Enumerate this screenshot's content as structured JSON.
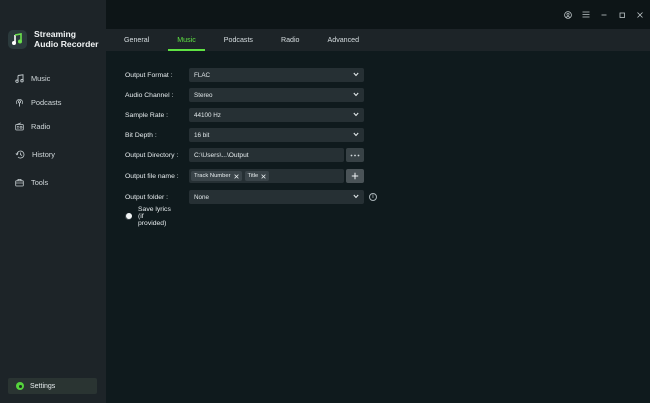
{
  "app": {
    "name_line1": "Streaming",
    "name_line2": "Audio Recorder"
  },
  "sidebar": {
    "items": [
      {
        "label": "Music",
        "icon": "music-icon"
      },
      {
        "label": "Podcasts",
        "icon": "podcast-icon"
      },
      {
        "label": "Radio",
        "icon": "radio-icon"
      },
      {
        "label": "History",
        "icon": "history-icon"
      },
      {
        "label": "Tools",
        "icon": "toolbox-icon"
      }
    ],
    "settings_label": "Settings"
  },
  "tabs": [
    {
      "label": "General",
      "active": false
    },
    {
      "label": "Music",
      "active": true
    },
    {
      "label": "Podcasts",
      "active": false
    },
    {
      "label": "Radio",
      "active": false
    },
    {
      "label": "Advanced",
      "active": false
    }
  ],
  "form": {
    "output_format": {
      "label": "Output Format :",
      "value": "FLAC"
    },
    "audio_channel": {
      "label": "Audio Channel :",
      "value": "Stereo"
    },
    "sample_rate": {
      "label": "Sample Rate :",
      "value": "44100 Hz"
    },
    "bit_depth": {
      "label": "Bit Depth :",
      "value": "16 bit"
    },
    "output_directory": {
      "label": "Output Directory :",
      "value": "C:\\Users\\...\\Output",
      "browse_label": "···"
    },
    "output_file_name": {
      "label": "Output file name :",
      "chips": [
        "Track Number",
        "Title"
      ],
      "add_label": "+"
    },
    "output_folder": {
      "label": "Output folder :",
      "value": "None",
      "info_label": "i"
    },
    "save_lyrics": {
      "label": "Save lyrics (if provided)",
      "enabled": false
    }
  },
  "colors": {
    "accent": "#5fe243",
    "sidebar_bg": "#1d2428",
    "main_bg": "#0f1a1d",
    "input_bg": "#263034"
  }
}
